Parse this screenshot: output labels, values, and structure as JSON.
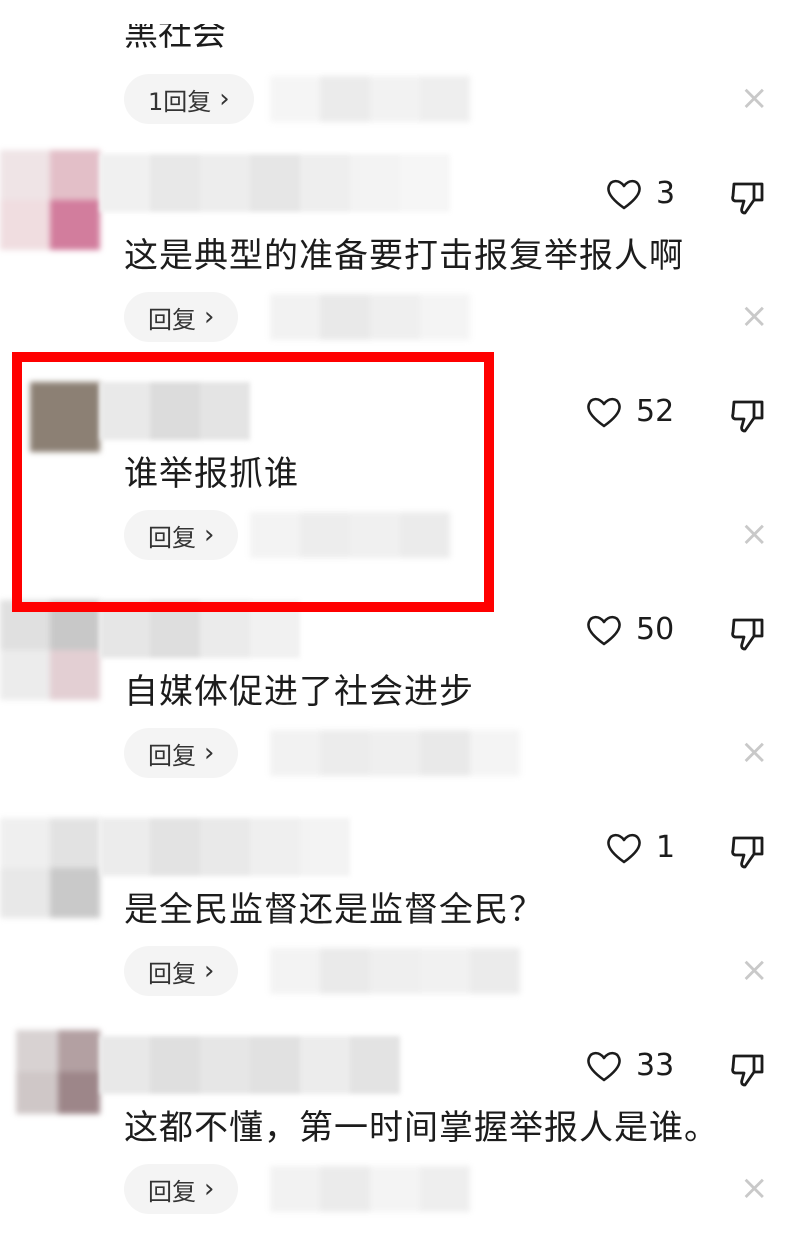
{
  "top": {
    "text": "黑社会",
    "reply_label": "1回复"
  },
  "comments": [
    {
      "text": "这是典型的准备要打击报复举报人啊",
      "likes": "3",
      "reply_label": "回复"
    },
    {
      "text": "谁举报抓谁",
      "likes": "52",
      "reply_label": "回复"
    },
    {
      "text": "自媒体促进了社会进步",
      "likes": "50",
      "reply_label": "回复"
    },
    {
      "text": "是全民监督还是监督全民？",
      "likes": "1",
      "reply_label": "回复"
    },
    {
      "text": "这都不懂，第一时间掌握举报人是谁。",
      "likes": "33",
      "reply_label": "回复"
    }
  ],
  "icons": {
    "like": "heart-outline-icon",
    "dislike": "thumbs-down-icon",
    "dismiss": "close-icon",
    "reply_chevron": "chevron-right-icon"
  },
  "colors": {
    "highlight": "#ff0000",
    "reply_bg": "#f4f4f4",
    "dismiss": "#c9c9c9"
  },
  "chevron": "›",
  "dismiss_glyph": "×"
}
